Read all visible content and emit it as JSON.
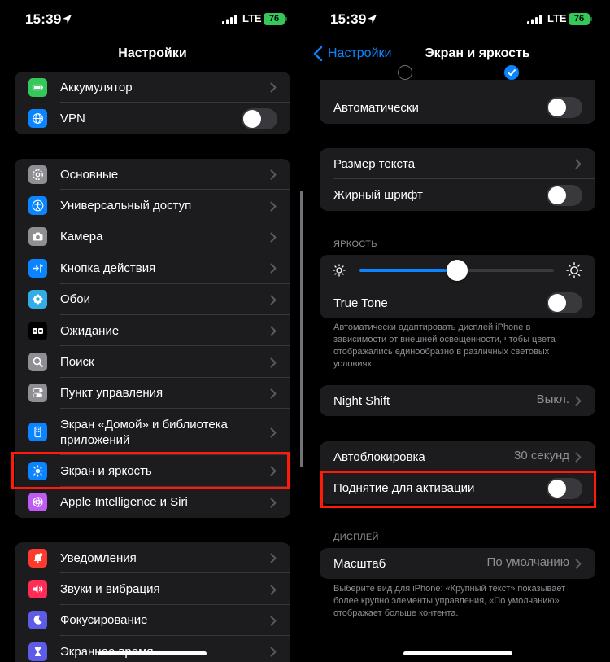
{
  "status": {
    "time": "15:39",
    "network": "LTE",
    "battery": "76"
  },
  "left": {
    "title": "Настройки",
    "group1": [
      {
        "label": "Аккумулятор",
        "icon": "battery-icon",
        "color": "#34c759",
        "control": "chevron"
      },
      {
        "label": "VPN",
        "icon": "globe-icon",
        "color": "#0a84ff",
        "control": "toggle"
      }
    ],
    "group2": [
      {
        "label": "Основные",
        "icon": "gear-icon",
        "color": "#8e8e93"
      },
      {
        "label": "Универсальный доступ",
        "icon": "accessibility-icon",
        "color": "#0a84ff"
      },
      {
        "label": "Камера",
        "icon": "camera-icon",
        "color": "#8e8e93"
      },
      {
        "label": "Кнопка действия",
        "icon": "action-button-icon",
        "color": "#0a84ff"
      },
      {
        "label": "Обои",
        "icon": "flower-icon",
        "color": "#32ade6"
      },
      {
        "label": "Ожидание",
        "icon": "standby-icon",
        "color": "#1c1c1e"
      },
      {
        "label": "Поиск",
        "icon": "search-icon",
        "color": "#8e8e93"
      },
      {
        "label": "Пункт управления",
        "icon": "toggles-icon",
        "color": "#8e8e93"
      },
      {
        "label": "Экран «Домой» и библиотека приложений",
        "icon": "home-screen-icon",
        "color": "#0a84ff"
      },
      {
        "label": "Экран и яркость",
        "icon": "sun-icon",
        "color": "#0a84ff"
      },
      {
        "label": "Apple Intelligence и Siri",
        "icon": "siri-icon",
        "color": "#bf5af2"
      }
    ],
    "group3": [
      {
        "label": "Уведомления",
        "icon": "bell-icon",
        "color": "#ff3b30"
      },
      {
        "label": "Звуки и вибрация",
        "icon": "speaker-icon",
        "color": "#ff2d55"
      },
      {
        "label": "Фокусирование",
        "icon": "moon-icon",
        "color": "#5e5ce6"
      },
      {
        "label": "Экранное время",
        "icon": "hourglass-icon",
        "color": "#5e5ce6"
      }
    ]
  },
  "right": {
    "back": "Настройки",
    "title": "Экран и яркость",
    "auto_label": "Автоматически",
    "text_size": "Размер текста",
    "bold_text": "Жирный шрифт",
    "brightness_header": "ЯРКОСТЬ",
    "brightness_level": 0.5,
    "true_tone": "True Tone",
    "true_tone_note": "Автоматически адаптировать дисплей iPhone в зависимости от внешней освещенности, чтобы цвета отображались единообразно в различных световых условиях.",
    "night_shift": "Night Shift",
    "night_shift_value": "Выкл.",
    "autolock": "Автоблокировка",
    "autolock_value": "30 секунд",
    "raise_to_wake": "Поднятие для активации",
    "display_header": "ДИСПЛЕЙ",
    "zoom": "Масштаб",
    "zoom_value": "По умолчанию",
    "zoom_note": "Выберите вид для iPhone: «Крупный текст» показывает более крупно элементы управления, «По умолчанию» отображает больше контента."
  },
  "colors": {
    "accent": "#0a84ff",
    "highlight": "#ff1a0a",
    "cell": "#1c1c1e"
  }
}
